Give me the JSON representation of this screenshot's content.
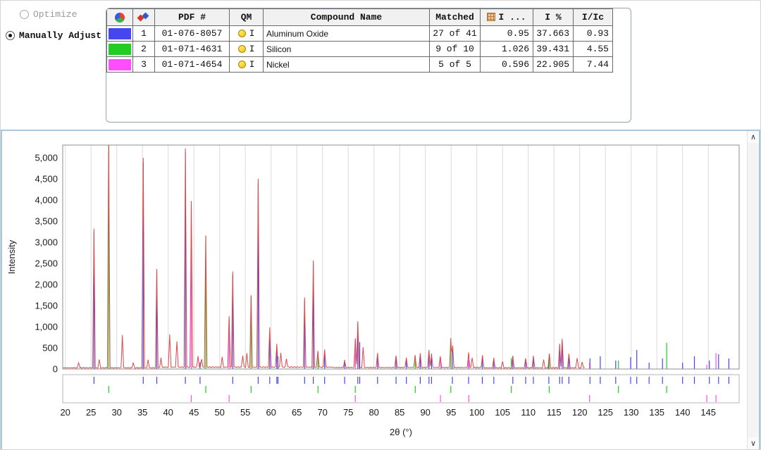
{
  "controls": {
    "optimize_label": "Optimize",
    "manually_adjust_label": "Manually Adjust"
  },
  "icons": {
    "scroll_up": "∧",
    "scroll_down": "∨"
  },
  "table": {
    "headers": {
      "pdf": "PDF #",
      "qm": "QM",
      "compound": "Compound Name",
      "matched": "Matched",
      "i_col": "I ...",
      "i_pct": "I %",
      "i_ic": "I/Ic"
    },
    "rows": [
      {
        "color": "#4646f0",
        "num": "1",
        "pdf": "01-076-8057",
        "qm": "I",
        "compound": "Aluminum Oxide",
        "matched": "27 of 41",
        "i_val": "0.95",
        "i_pct": "37.663",
        "i_ic": "0.93"
      },
      {
        "color": "#22cc22",
        "num": "2",
        "pdf": "01-071-4631",
        "qm": "I",
        "compound": "Silicon",
        "matched": "9 of 10",
        "i_val": "1.026",
        "i_pct": "39.431",
        "i_ic": "4.55"
      },
      {
        "color": "#ff4dff",
        "num": "3",
        "pdf": "01-071-4654",
        "qm": "I",
        "compound": "Nickel",
        "matched": "5 of 5",
        "i_val": "0.596",
        "i_pct": "22.905",
        "i_ic": "7.44"
      }
    ]
  },
  "chart_data": {
    "type": "line",
    "title": "",
    "xlabel": "2θ (°)",
    "ylabel": "Intensity",
    "xlim": [
      19.5,
      151.0
    ],
    "ylim": [
      0,
      5300
    ],
    "grid": "vertical",
    "xticks": [
      20,
      25,
      30,
      35,
      40,
      45,
      50,
      55,
      60,
      65,
      70,
      75,
      80,
      85,
      90,
      95,
      100,
      105,
      110,
      115,
      120,
      125,
      130,
      135,
      140,
      145
    ],
    "yticks": [
      0,
      500,
      1000,
      1500,
      2000,
      2500,
      3000,
      3500,
      4000,
      4500,
      5000
    ],
    "pattern": {
      "name": "measured-xrd-pattern",
      "color": "#dd4a4a",
      "x_start": 19.6,
      "x_end": 121.0,
      "peaks": [
        [
          22.6,
          130
        ],
        [
          25.58,
          3300
        ],
        [
          26.6,
          190
        ],
        [
          28.44,
          5420
        ],
        [
          31.1,
          770
        ],
        [
          33.2,
          120
        ],
        [
          35.15,
          4960
        ],
        [
          36.1,
          200
        ],
        [
          37.78,
          2330
        ],
        [
          38.6,
          240
        ],
        [
          40.3,
          780
        ],
        [
          41.7,
          620
        ],
        [
          43.35,
          5180
        ],
        [
          44.5,
          3920
        ],
        [
          45.8,
          260
        ],
        [
          46.5,
          200
        ],
        [
          47.3,
          3120
        ],
        [
          50.5,
          240
        ],
        [
          51.85,
          1210
        ],
        [
          52.55,
          2260
        ],
        [
          54.5,
          280
        ],
        [
          55.3,
          330
        ],
        [
          56.12,
          1700
        ],
        [
          57.5,
          4470
        ],
        [
          59.74,
          930
        ],
        [
          61.12,
          550
        ],
        [
          61.9,
          340
        ],
        [
          63.0,
          200
        ],
        [
          66.52,
          1640
        ],
        [
          68.21,
          2520
        ],
        [
          69.1,
          390
        ],
        [
          70.42,
          430
        ],
        [
          74.3,
          170
        ],
        [
          76.38,
          690
        ],
        [
          76.87,
          1090
        ],
        [
          77.9,
          490
        ],
        [
          80.7,
          340
        ],
        [
          84.3,
          280
        ],
        [
          86.3,
          240
        ],
        [
          88.0,
          290
        ],
        [
          89.0,
          330
        ],
        [
          90.7,
          420
        ],
        [
          91.2,
          330
        ],
        [
          92.9,
          270
        ],
        [
          94.95,
          700
        ],
        [
          95.3,
          520
        ],
        [
          98.4,
          350
        ],
        [
          99.1,
          240
        ],
        [
          101.1,
          300
        ],
        [
          103.3,
          230
        ],
        [
          105.0,
          150
        ],
        [
          107.0,
          280
        ],
        [
          109.5,
          230
        ],
        [
          111.0,
          280
        ],
        [
          113.0,
          190
        ],
        [
          114.1,
          340
        ],
        [
          116.1,
          560
        ],
        [
          116.6,
          680
        ],
        [
          117.9,
          330
        ],
        [
          119.5,
          240
        ],
        [
          120.5,
          140
        ]
      ]
    },
    "phases": [
      {
        "name": "Aluminum Oxide",
        "pdf": "01-076-8057",
        "color": "#4646f0",
        "sticks": [
          [
            25.58,
            3240
          ],
          [
            35.15,
            4890
          ],
          [
            37.78,
            2290
          ],
          [
            43.35,
            5140
          ],
          [
            46.2,
            160
          ],
          [
            52.55,
            2230
          ],
          [
            57.5,
            4410
          ],
          [
            59.74,
            900
          ],
          [
            61.12,
            530
          ],
          [
            61.35,
            300
          ],
          [
            66.52,
            1610
          ],
          [
            68.21,
            2470
          ],
          [
            70.42,
            410
          ],
          [
            74.3,
            160
          ],
          [
            76.87,
            1070
          ],
          [
            77.23,
            640
          ],
          [
            80.7,
            320
          ],
          [
            84.3,
            260
          ],
          [
            86.3,
            220
          ],
          [
            89.0,
            310
          ],
          [
            90.7,
            400
          ],
          [
            91.2,
            310
          ],
          [
            95.25,
            500
          ],
          [
            98.4,
            200
          ],
          [
            101.07,
            290
          ],
          [
            103.3,
            210
          ],
          [
            107.0,
            260
          ],
          [
            109.5,
            210
          ],
          [
            111.0,
            260
          ],
          [
            114.0,
            200
          ],
          [
            116.1,
            540
          ],
          [
            116.6,
            660
          ],
          [
            117.9,
            310
          ],
          [
            122.0,
            250
          ],
          [
            124.0,
            300
          ],
          [
            127.0,
            200
          ],
          [
            129.9,
            280
          ],
          [
            131.1,
            450
          ],
          [
            133.5,
            150
          ],
          [
            136.1,
            250
          ],
          [
            140.0,
            150
          ],
          [
            142.3,
            300
          ],
          [
            145.2,
            200
          ],
          [
            147.0,
            350
          ],
          [
            149.0,
            250
          ]
        ]
      },
      {
        "name": "Silicon",
        "pdf": "01-071-4631",
        "color": "#22cc22",
        "sticks": [
          [
            28.44,
            5390
          ],
          [
            47.3,
            3150
          ],
          [
            56.12,
            1730
          ],
          [
            69.13,
            380
          ],
          [
            76.38,
            650
          ],
          [
            88.03,
            280
          ],
          [
            94.95,
            680
          ],
          [
            106.71,
            260
          ],
          [
            114.08,
            330
          ],
          [
            127.54,
            200
          ],
          [
            136.9,
            620
          ]
        ]
      },
      {
        "name": "Nickel",
        "pdf": "01-071-4654",
        "color": "#ff4dff",
        "sticks": [
          [
            44.5,
            3900
          ],
          [
            51.85,
            1180
          ],
          [
            76.37,
            680
          ],
          [
            92.94,
            270
          ],
          [
            98.45,
            340
          ],
          [
            121.9,
            150
          ],
          [
            144.7,
            100
          ],
          [
            146.5,
            380
          ]
        ]
      }
    ]
  }
}
